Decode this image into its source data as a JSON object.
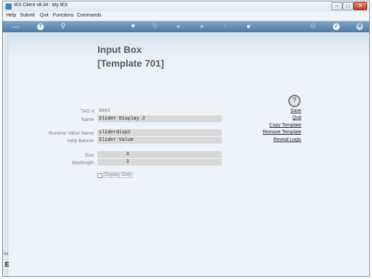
{
  "window": {
    "title": "IES Client v8.34 : My IES",
    "controls": {
      "minimize": "–",
      "maximize": "□",
      "close": "✕"
    }
  },
  "menubar": {
    "items": [
      "Help",
      "Submit",
      "Quit",
      "Functions",
      "Commands"
    ]
  },
  "toolbar": {
    "buttons": [
      {
        "name": "key-icon",
        "glyph": "─○"
      },
      {
        "name": "help-icon",
        "glyph": "?"
      },
      {
        "name": "search-icon",
        "glyph": "⚲"
      },
      {
        "name": "heart-icon",
        "glyph": "♥"
      },
      {
        "name": "refresh-icon",
        "glyph": "↻"
      },
      {
        "name": "rewind-icon",
        "glyph": "«"
      },
      {
        "name": "fast-forward-icon",
        "glyph": "»"
      },
      {
        "name": "upload-icon",
        "glyph": "↑"
      },
      {
        "name": "stop-icon",
        "glyph": "■"
      },
      {
        "name": "settings-icon",
        "glyph": "⚙"
      },
      {
        "name": "ok-icon",
        "glyph": "✓"
      },
      {
        "name": "close-icon",
        "glyph": "✕"
      }
    ]
  },
  "sidebar": {
    "text": "Se",
    "letter": "E"
  },
  "page": {
    "title": "Input Box",
    "subtitle": "[Template 701]"
  },
  "form": {
    "tag_label": "TAG #",
    "tag_value": "0002",
    "name_label": "Name",
    "name_value": "Slider Display 2",
    "runtime_label": "Runtime Value Name",
    "runtime_value": "sliderdisp2",
    "banner_label": "Help Banner",
    "banner_value": "Slider Value",
    "size_label": "Size",
    "size_value": "3",
    "maxlength_label": "Maxlength",
    "maxlength_value": "3",
    "display_only_label": "Display Only",
    "display_only_checked": false
  },
  "actions": {
    "help": "?",
    "save": "Save",
    "quit": "Quit",
    "copy": "Copy Template",
    "remove": "Remove Template",
    "reveal": "Reveal Logic"
  }
}
